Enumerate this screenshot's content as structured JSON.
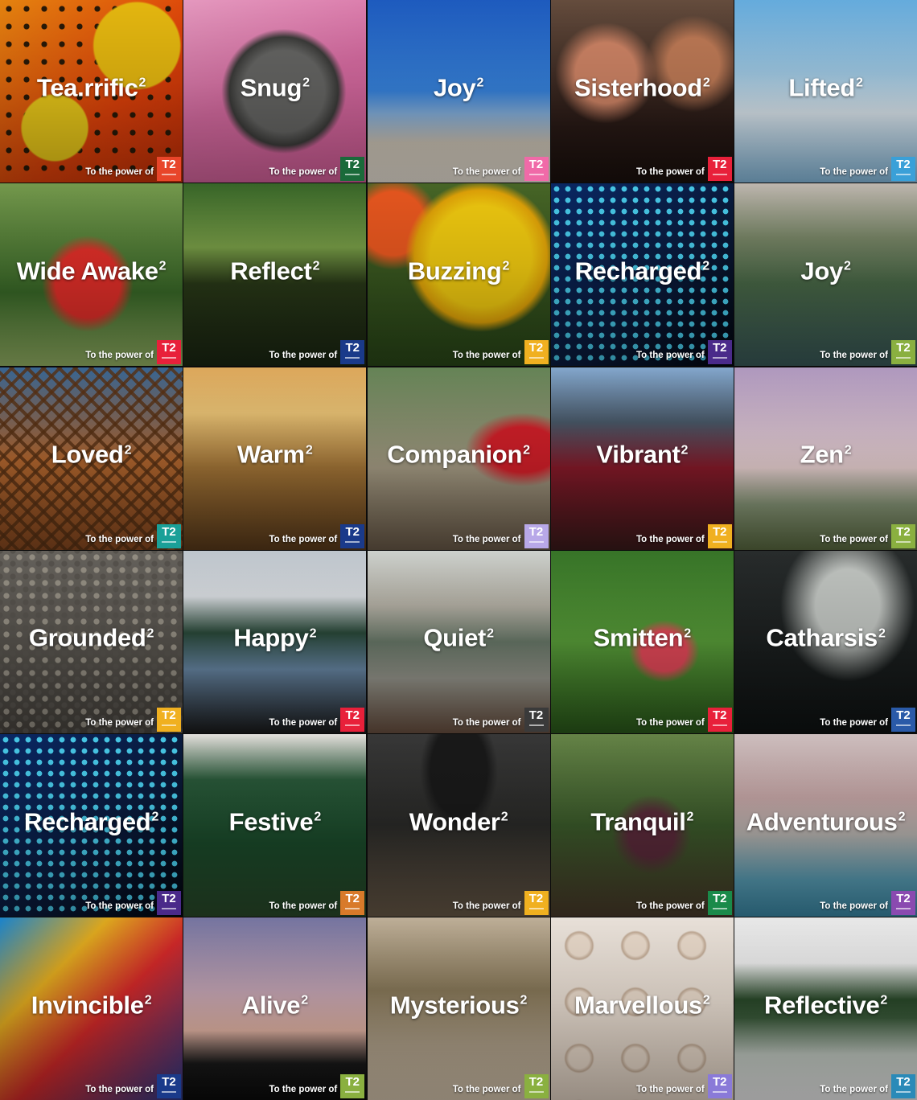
{
  "tagline": "To the power of",
  "badge_text": "T2",
  "superscript": "2",
  "tiles": [
    {
      "word": "Tea.rrific",
      "badge_color": "#e8452a",
      "bg": "radial-gradient(circle at 30% 70%, #f4d11a 0 18%, transparent 19%), radial-gradient(circle at 75% 25%, #f0c010 0 22%, transparent 23%), radial-gradient(#2a1a08 22%, transparent 24%) 0 0/22px 22px, linear-gradient(135deg,#f08a10,#e8440a 60%,#c83008)"
    },
    {
      "word": "Snug",
      "badge_color": "#1a6a3a",
      "bg": "radial-gradient(circle at 55% 50%, #6a6a68 0 30%, #3e3e3c 40%, transparent 46%), linear-gradient(160deg,#f0a0c8,#e070a8 50%,#d9609c)"
    },
    {
      "word": "Joy",
      "badge_color": "#f06aa8",
      "bg": "linear-gradient(180deg,#1f5fc8 0%,#3a8ae8 50%,#8ab8e8 62%,#d8cfc0 78%,#f0e8dc 100%)"
    },
    {
      "word": "Sisterhood",
      "badge_color": "#e8203a",
      "bg": "radial-gradient(circle at 30% 40%, #d88a6a 0 18%, transparent 30%), radial-gradient(circle at 78% 35%, #c8805a 0 14%, transparent 26%), linear-gradient(180deg,#6a5040,#2a1a16 70%,#1a100c)"
    },
    {
      "word": "Lifted",
      "badge_color": "#3aa0d8",
      "bg": "linear-gradient(180deg,#6ab4e8 0%,#a8d4f0 40%,#e6f2fa 62%,#8ac0e4 100%)"
    },
    {
      "word": "Wide Awake",
      "badge_color": "#e8203a",
      "bg": "radial-gradient(ellipse at 48% 55%, #e8302a 0 24%, transparent 34%), linear-gradient(180deg,#7aa050,#3a6a28 60%,#9ab868)"
    },
    {
      "word": "Reflect",
      "badge_color": "#1a3a8a",
      "bg": "linear-gradient(180deg,#3a6a2a 0%,#7aa048 35%,#2a3a18 55%,#1a2612 100%)"
    },
    {
      "word": "Buzzing",
      "badge_color": "#f0b020",
      "bg": "radial-gradient(circle at 62% 40%, #f8d010 0 32%, #e8a808 42%, transparent 48%), radial-gradient(circle at 14% 22%, #f05a20 0 15%, transparent 22%), linear-gradient(180deg,#4a6a28,#2a4818)"
    },
    {
      "word": "Recharged",
      "badge_color": "#4a2a8a",
      "bg": "radial-gradient(#4ad0f0 32%, transparent 36%) 0 0/14px 14px, linear-gradient(135deg,#0a2a6a,#0a1a3a 60%,#02060e)"
    },
    {
      "word": "Joy",
      "badge_color": "#8ab040",
      "bg": "linear-gradient(180deg,#c8c0b8 0%,#7a8868 30%,#4a6a48 55%,#3a5a5a 100%)"
    },
    {
      "word": "Loved",
      "badge_color": "#1aa098",
      "bg": "repeating-linear-gradient(45deg, rgba(90,50,20,0.8) 0 4px, transparent 4px 14px), repeating-linear-gradient(-45deg, rgba(90,50,20,0.8) 0 4px, transparent 4px 14px), linear-gradient(180deg,#3a6a9a,#b86a30 50%,#8a4a20)"
    },
    {
      "word": "Warm",
      "badge_color": "#1a3a8a",
      "bg": "linear-gradient(180deg,#e8b060 0%,#f0c878 25%,#a87838 55%,#5a3a1a 100%)"
    },
    {
      "word": "Companion",
      "badge_color": "#b8a8e8",
      "bg": "radial-gradient(ellipse at 85% 45%, #d8202a 0 16%, transparent 26%), linear-gradient(180deg,#6a8a5a,#aaa088 55%,#6a5a48)"
    },
    {
      "word": "Vibrant",
      "badge_color": "#f0b020",
      "bg": "linear-gradient(180deg,#8ab0d8 0%,#4a5a6a 30%,#8a1a2a 55%,#3a1a1a 100%)"
    },
    {
      "word": "Zen",
      "badge_color": "#8ab040",
      "bg": "linear-gradient(180deg,#b8a0c8 0%,#e0c8d8 35%,#f0d8d8 55%,#8a9a7a 75%,#5a6a40 100%)"
    },
    {
      "word": "Grounded",
      "badge_color": "#f0b020",
      "bg": "radial-gradient(#9a9488 30%, transparent 34%) 0 0/16px 16px, radial-gradient(#5a5650 30%, transparent 34%) 8px 8px/16px 16px, linear-gradient(180deg,#6a6660,#4a4640)"
    },
    {
      "word": "Happy",
      "badge_color": "#e8203a",
      "bg": "linear-gradient(180deg,#c8d0d8 0%,#e0e4e8 25%,#2a4a3a 45%,#6a8aa8 65%,#1a1a1a 100%)"
    },
    {
      "word": "Quiet",
      "badge_color": "#3a3a3a",
      "bg": "linear-gradient(180deg,#d8dcd8 0%,#b8b4a8 30%,#6a7a6a 50%,#9a9a90 70%,#6a5040 100%)"
    },
    {
      "word": "Smitten",
      "badge_color": "#e8203a",
      "bg": "radial-gradient(ellipse at 62% 55%, #e84a5a 0 14%, transparent 22%), linear-gradient(180deg,#3a7a2a,#5aa03a 50%,#2a5a1a)"
    },
    {
      "word": "Catharsis",
      "badge_color": "#2a5aa8",
      "bg": "radial-gradient(ellipse at 62% 30%, #c8ccc8 0 20%, transparent 42%), linear-gradient(180deg,#2a2e2e,#0e1212)"
    },
    {
      "word": "Recharged",
      "badge_color": "#4a2a8a",
      "bg": "radial-gradient(#4ad0f0 32%, transparent 36%) 0 0/14px 14px, linear-gradient(135deg,#0a2a6a,#0a1a3a 60%,#02060e)"
    },
    {
      "word": "Festive",
      "badge_color": "#d87a2a",
      "bg": "linear-gradient(180deg,#f0ece8 0%,#2a5a3a 25%,#1a4a2a 60%,#2a4a2a 100%)"
    },
    {
      "word": "Wonder",
      "badge_color": "#f0b020",
      "bg": "radial-gradient(ellipse at 50% 20%, #1a1a1a 0 22%, transparent 30%), linear-gradient(180deg,#3a3a3a,#2a2a28 50%,#6a5a48)"
    },
    {
      "word": "Tranquil",
      "badge_color": "#1a8a4a",
      "bg": "radial-gradient(ellipse at 55% 55%, #5a2a3a 0 16%, transparent 28%), linear-gradient(180deg,#6a8a4a,#3a5a2a 50%,#4a3a2a)"
    },
    {
      "word": "Adventurous",
      "badge_color": "#8a4ab0",
      "bg": "linear-gradient(180deg,#d8c8c8 0%,#c8a8a8 35%,#b8b4b0 55%,#5aa0b8 80%,#3a8aa8 100%)"
    },
    {
      "word": "Invincible",
      "badge_color": "#1a3a8a",
      "bg": "linear-gradient(135deg,#1a8ad8 0%,#e8b020 30%,#d82a2a 55%,#2a3a8a 100%)"
    },
    {
      "word": "Alive",
      "badge_color": "#8ab040",
      "bg": "linear-gradient(180deg,#7a7aa8 0%,#c8a8b8 40%,#e8b8a8 62%,#1a1a1a 80%,#0a0a0a 100%)"
    },
    {
      "word": "Mysterious",
      "badge_color": "#8ab040",
      "bg": "linear-gradient(180deg,#c8b8a0 0%,#8a7a5a 40%,#b8a890 70%,#d8c8b0 100%)"
    },
    {
      "word": "Marvellous",
      "badge_color": "#8a7ad8",
      "bg": "radial-gradient(circle, #f0e0d0 0 26%, #c8b09a 34%, transparent 38%) 0 0/70px 70px, linear-gradient(180deg,#f4ece4,#e8d8c8)"
    },
    {
      "word": "Reflective",
      "badge_color": "#2a8ab8",
      "bg": "linear-gradient(180deg,#f4f4f4 0%,#f0f0f0 25%,#2a4a2a 45%,#3a5a3a 55%,#c8d0c8 75%,#f0f0f0 100%)"
    }
  ]
}
